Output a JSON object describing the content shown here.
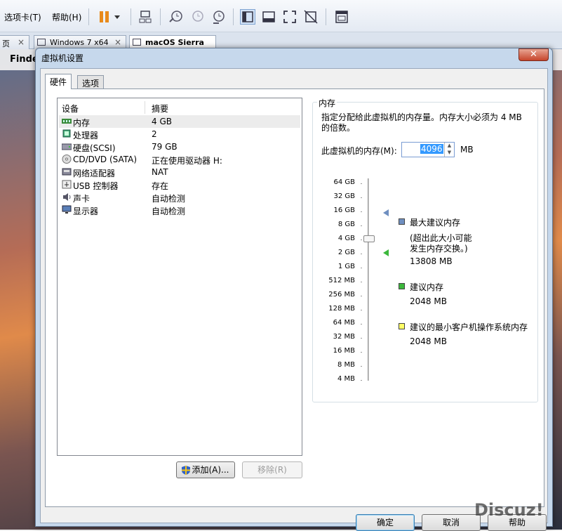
{
  "menu": {
    "tabs_label": "选项卡(T)",
    "help_label": "帮助(H)"
  },
  "tabs": [
    {
      "label": "页"
    },
    {
      "label": "Windows 7 x64"
    },
    {
      "label": "macOS Sierra"
    }
  ],
  "mac": {
    "app": "Finde"
  },
  "dialog": {
    "title": "虚拟机设置",
    "close": "✕",
    "tabs": {
      "hardware": "硬件",
      "options": "选项"
    },
    "columns": {
      "device": "设备",
      "summary": "摘要"
    },
    "devices": [
      {
        "name": "内存",
        "summary": "4 GB"
      },
      {
        "name": "处理器",
        "summary": "2"
      },
      {
        "name": "硬盘(SCSI)",
        "summary": "79 GB"
      },
      {
        "name": "CD/DVD (SATA)",
        "summary": "正在使用驱动器 H:"
      },
      {
        "name": "网络适配器",
        "summary": "NAT"
      },
      {
        "name": "USB 控制器",
        "summary": "存在"
      },
      {
        "name": "声卡",
        "summary": "自动检测"
      },
      {
        "name": "显示器",
        "summary": "自动检测"
      }
    ],
    "add_btn": "添加(A)...",
    "remove_btn": "移除(R)",
    "memory": {
      "legend": "内存",
      "desc1": "指定分配给此虚拟机的内存量。内存大小必须为 4 MB",
      "desc2": "的倍数。",
      "field_label": "此虚拟机的内存(M):",
      "value": "4096",
      "unit": "MB",
      "ticks": [
        "64 GB",
        "32 GB",
        "16 GB",
        "8 GB",
        "4 GB",
        "2 GB",
        "1 GB",
        "512 MB",
        "256 MB",
        "128 MB",
        "64 MB",
        "32 MB",
        "16 MB",
        "8 MB",
        "4 MB"
      ],
      "max_label": "最大建议内存",
      "max_note1": "(超出此大小可能",
      "max_note2": "发生内存交换。)",
      "max_value": "13808 MB",
      "rec_label": "建议内存",
      "rec_value": "2048 MB",
      "min_label": "建议的最小客户机操作系统内存",
      "min_value": "2048 MB",
      "colors": {
        "max": "#6f8fc0",
        "rec": "#3cb83c",
        "min": "#ffff66"
      }
    },
    "ok": "确定",
    "cancel": "取消",
    "help": "帮助"
  },
  "watermark": "Discuz!"
}
